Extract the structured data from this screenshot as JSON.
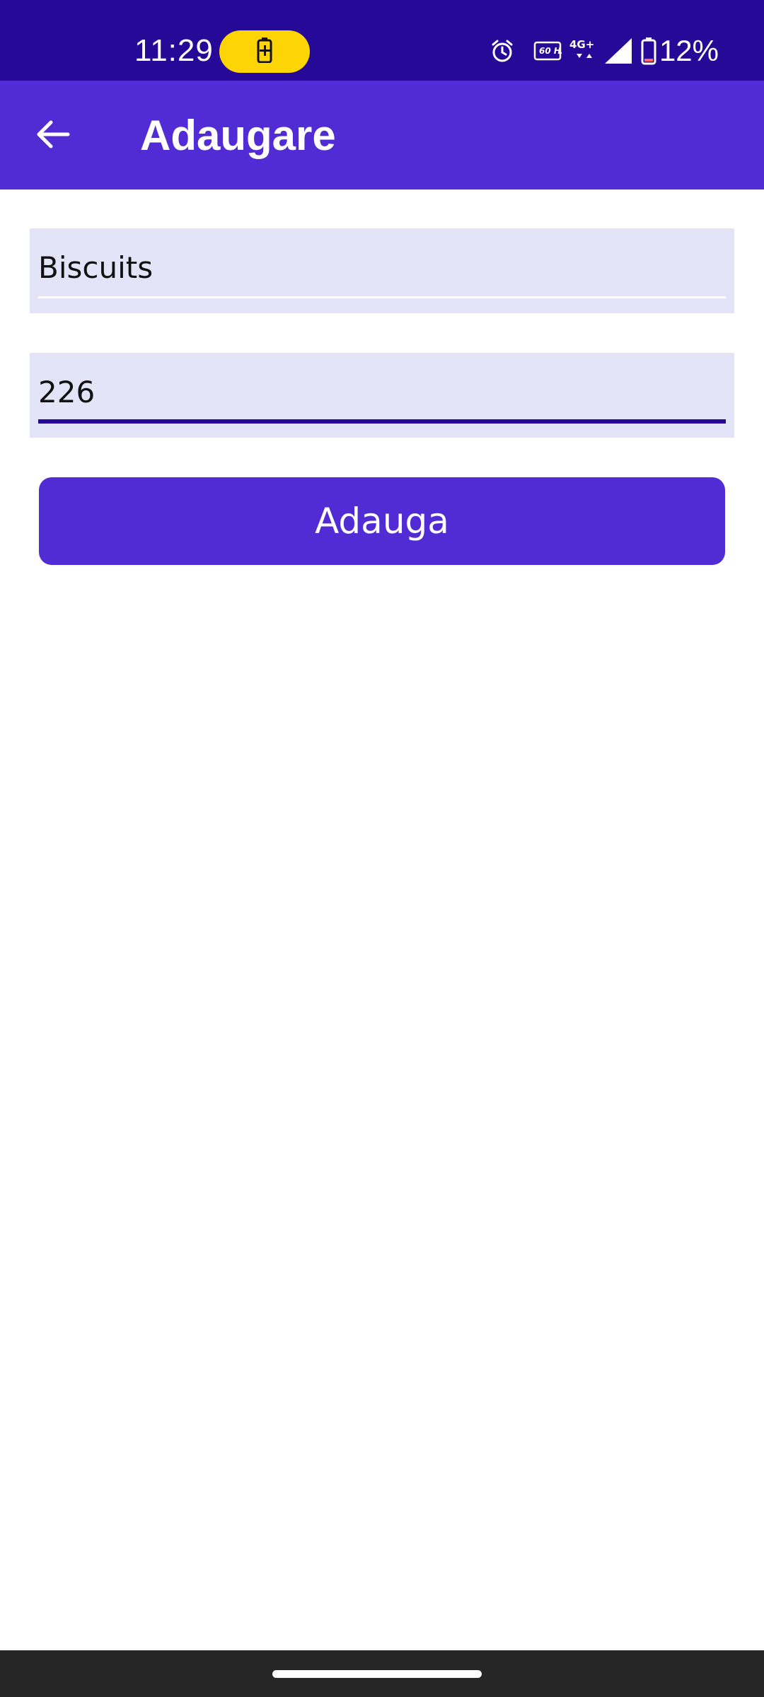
{
  "status_bar": {
    "time": "11:29",
    "battery_percent": "12%",
    "network_label": "4G+",
    "refresh_rate": "60 Hz",
    "icons": [
      "charging-icon",
      "alarm-icon",
      "refresh-rate-icon",
      "network-4g-icon",
      "signal-icon",
      "battery-icon"
    ],
    "colors": {
      "background": "#270997",
      "charging_pill": "#fdd505"
    }
  },
  "app_bar": {
    "title": "Adaugare",
    "back_icon": "arrow-left-icon",
    "colors": {
      "background": "#512bd4",
      "text": "#ffffff"
    }
  },
  "form": {
    "name_field": {
      "value": "Biscuits"
    },
    "quantity_field": {
      "value": "226"
    },
    "submit_label": "Adauga",
    "colors": {
      "field_background": "#e4e4f8",
      "focus_underline": "#270997",
      "button": "#512bd4"
    }
  },
  "nav_bar": {
    "colors": {
      "background": "#262626",
      "indicator": "#ffffff"
    }
  }
}
